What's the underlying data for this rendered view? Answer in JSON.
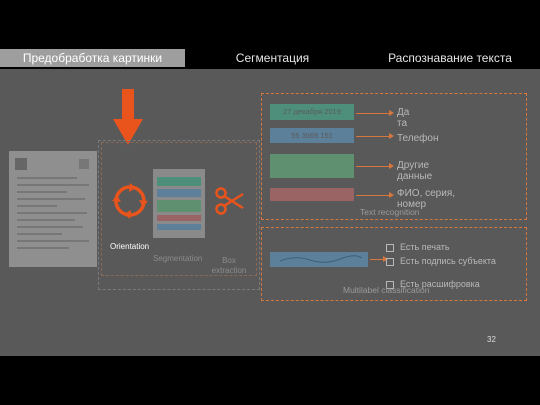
{
  "tabs": [
    "Предобработка картинки",
    "Сегментация",
    "Распознавание текста"
  ],
  "pipeline": {
    "orientation": "Orientation",
    "segmentation": "Segmentation",
    "box_extraction": "Box\nextraction"
  },
  "text_recognition": {
    "title": "Text recognition",
    "fields": [
      {
        "crop": "27 декабря 2019",
        "label": "Дата"
      },
      {
        "crop": "55 3569 151",
        "label": "Телефон"
      },
      {
        "crop": "",
        "label": "Другие данные"
      },
      {
        "crop": "",
        "label": "ФИО, серия, номер"
      }
    ]
  },
  "multilabel": {
    "title": "Multilabel classification",
    "items": [
      "Есть печать",
      "Есть подпись субъекта",
      "Есть расшифровка"
    ]
  },
  "page_number": "32",
  "colors": {
    "accent": "#d6783e",
    "panel": "#595959",
    "field_teal": "#4e8f7c",
    "field_blue": "#5c7f9a",
    "field_red": "#9a6464",
    "field_green": "#5f9070"
  }
}
